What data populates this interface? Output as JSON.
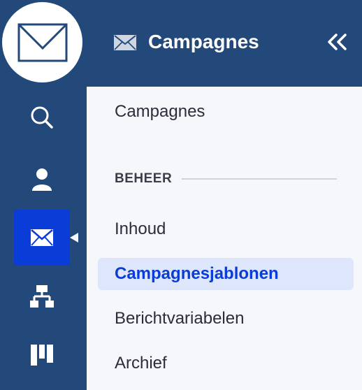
{
  "header": {
    "title": "Campagnes",
    "icon": "envelope-icon",
    "collapse_icon": "double-chevron-left-icon"
  },
  "rail": {
    "logo_icon": "envelope-logo-icon",
    "items": [
      {
        "icon": "search-icon",
        "active": false
      },
      {
        "icon": "user-icon",
        "active": false
      },
      {
        "icon": "envelope-icon",
        "active": true
      },
      {
        "icon": "hierarchy-icon",
        "active": false
      },
      {
        "icon": "board-icon",
        "active": false
      }
    ]
  },
  "panel": {
    "top_item": "Campagnes",
    "section": {
      "title": "BEHEER",
      "items": [
        "Inhoud",
        "Campagnesjablonen",
        "Berichtvariabelen",
        "Archief"
      ]
    },
    "selected_item": "Campagnesjablonen"
  },
  "colors": {
    "rail": "#23487a",
    "active": "#0a3cd7",
    "panel": "#f5f7fb",
    "selected_bg": "#dde6fa"
  }
}
